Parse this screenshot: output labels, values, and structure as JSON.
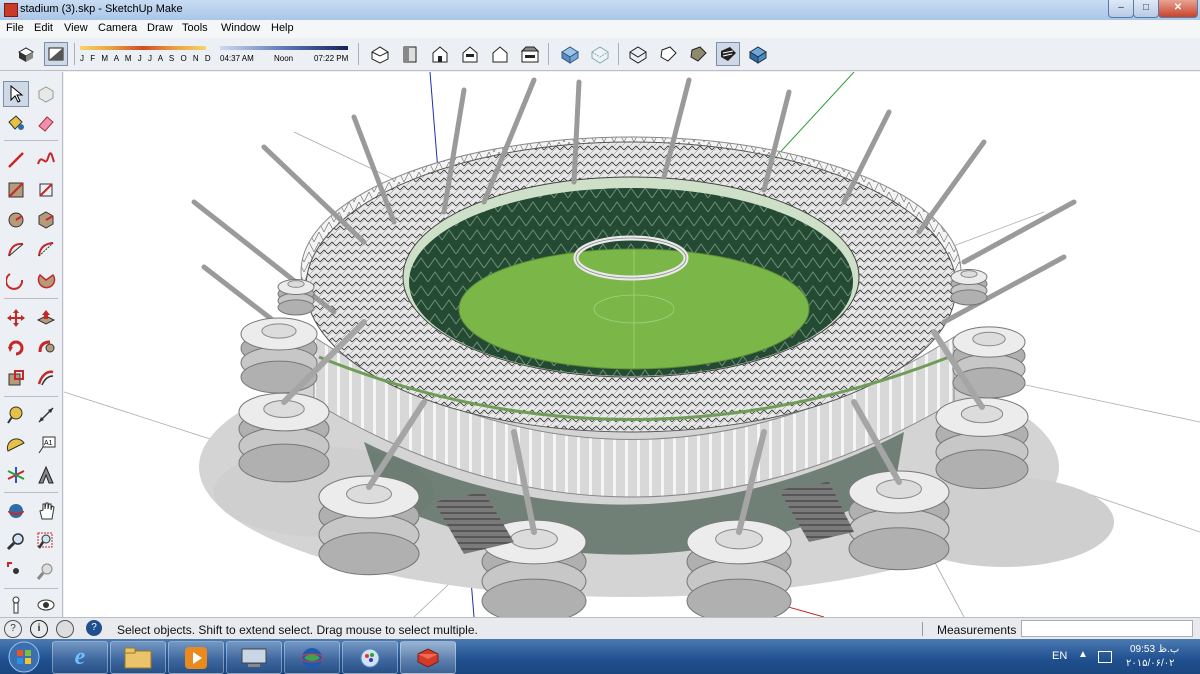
{
  "window": {
    "title": "stadium (3).skp - SketchUp Make",
    "controls": [
      "minimize-icon",
      "maximize-icon",
      "close-icon"
    ]
  },
  "menu": [
    "File",
    "Edit",
    "View",
    "Camera",
    "Draw",
    "Tools",
    "Window",
    "Help"
  ],
  "shadow_settings": {
    "months": "J F M A M J J A S O N D",
    "time_start": "04:37 AM",
    "time_mid": "Noon",
    "time_end": "07:22 PM"
  },
  "toolbar_icons": [
    "shadows-toggle-icon",
    "fog-icon",
    "iso-view-icon",
    "top-view-icon",
    "front-view-icon",
    "right-view-icon",
    "back-view-icon",
    "left-view-icon",
    "xray-icon",
    "back-edges-icon",
    "wireframe-icon",
    "hidden-line-icon",
    "shaded-icon",
    "shaded-textures-icon",
    "monochrome-icon"
  ],
  "left_tools": [
    [
      "select-icon",
      "make-component-icon"
    ],
    [
      "paint-bucket-icon",
      "eraser-icon"
    ],
    [
      "line-icon",
      "freehand-icon"
    ],
    [
      "rectangle-icon",
      "rotated-rectangle-icon"
    ],
    [
      "circle-icon",
      "polygon-icon"
    ],
    [
      "arc-icon",
      "two-point-arc-icon"
    ],
    [
      "three-point-arc-icon",
      "pie-icon"
    ],
    [
      "move-icon",
      "push-pull-icon"
    ],
    [
      "rotate-icon",
      "follow-me-icon"
    ],
    [
      "scale-icon",
      "offset-icon"
    ],
    [
      "tape-measure-icon",
      "dimension-icon"
    ],
    [
      "protractor-icon",
      "text-icon"
    ],
    [
      "axes-icon",
      "3d-text-icon"
    ],
    [
      "orbit-icon",
      "pan-icon"
    ],
    [
      "zoom-icon",
      "zoom-window-icon"
    ],
    [
      "zoom-extents-icon",
      "previous-view-icon"
    ],
    [
      "position-camera-icon",
      "look-around-icon"
    ]
  ],
  "status": {
    "message": "Select objects. Shift to extend select. Drag mouse to select multiple.",
    "measurements_label": "Measurements",
    "measurements_value": ""
  },
  "taskbar": {
    "apps": [
      "start-orb-icon",
      "internet-explorer-icon",
      "file-explorer-icon",
      "media-player-icon",
      "network-icon",
      "google-earth-icon",
      "paint-icon",
      "sketchup-icon"
    ],
    "language": "EN",
    "time": "09:53 ب.ظ",
    "date": "۲۰۱۵/۰۶/۰۲"
  },
  "colors": {
    "titlebar": "#b9d1ee",
    "taskbar": "#1f4f8f",
    "viewport_bg": "#ffffff",
    "pitch": "#7ab648",
    "seats": "#2f5a3a",
    "structure": "#d9d9d9"
  }
}
